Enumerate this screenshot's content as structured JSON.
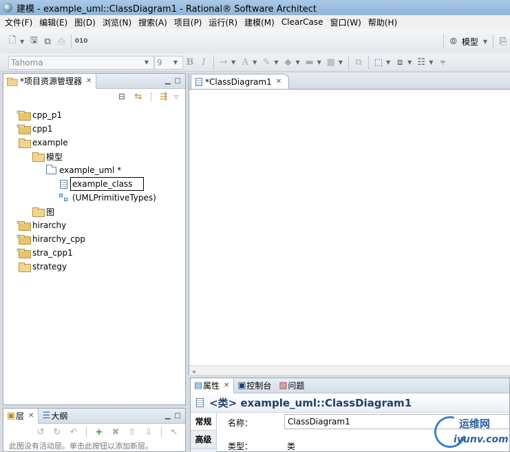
{
  "window": {
    "title": "建模 - example_uml::ClassDiagram1 - Rational® Software Architect"
  },
  "menu": [
    "文件(F)",
    "编辑(E)",
    "图(D)",
    "浏览(N)",
    "搜索(A)",
    "项目(P)",
    "运行(R)",
    "建模(M)",
    "ClearCase",
    "窗口(W)",
    "帮助(H)"
  ],
  "toolbar": {
    "perspective_label": "模型",
    "font_name": "Tahoma",
    "font_size": "9"
  },
  "project_explorer": {
    "tab_label": "*项目资源管理器",
    "tree": [
      {
        "label": "cpp_p1"
      },
      {
        "label": "cpp1"
      },
      {
        "label": "example"
      },
      {
        "label": "模型"
      },
      {
        "label": "example_uml *"
      },
      {
        "label": "example_class"
      },
      {
        "label": "(UMLPrimitiveTypes)"
      },
      {
        "label": "图"
      },
      {
        "label": "hirarchy"
      },
      {
        "label": "hirarchy_cpp"
      },
      {
        "label": "stra_cpp1"
      },
      {
        "label": "strategy"
      }
    ]
  },
  "outline": {
    "tab_layers": "层",
    "tab_outline": "大纲",
    "hint": "此图没有活动层。单击此按钮以添加新层。"
  },
  "editor": {
    "tab_label": "*ClassDiagram1"
  },
  "properties": {
    "tabs": [
      "属性",
      "控制台",
      "问题"
    ],
    "title": "<类> example_uml::ClassDiagram1",
    "side_tabs": [
      "常规",
      "高级"
    ],
    "name_label": "名称：",
    "name_value": "ClassDiagram1",
    "type_label": "类型：",
    "type_value": "类"
  },
  "watermark": {
    "text1": "运维网",
    "text2": "iyunv.com"
  }
}
